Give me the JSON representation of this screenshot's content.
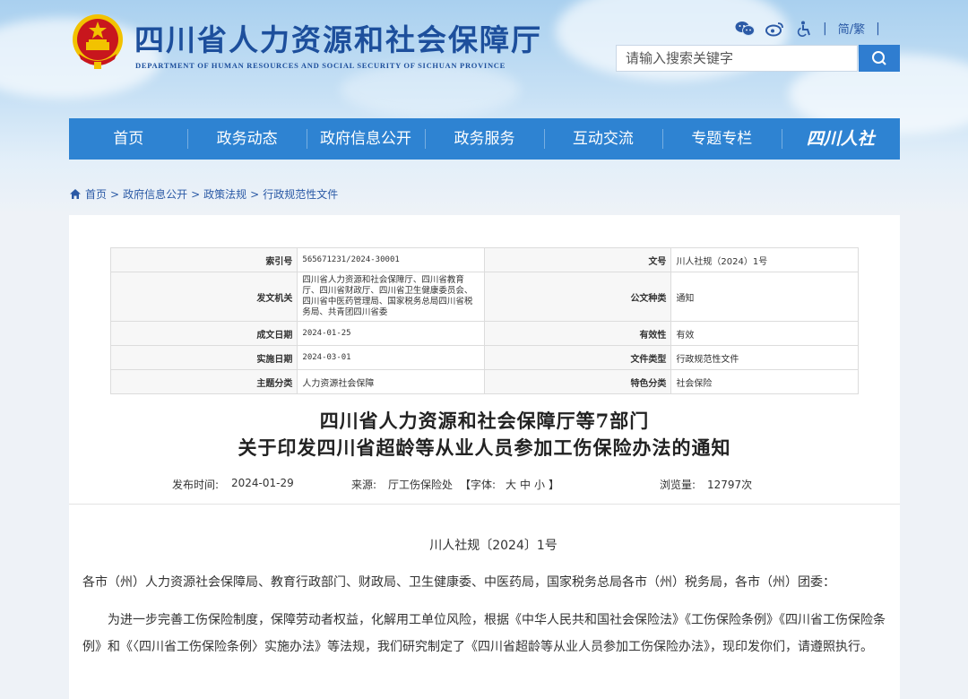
{
  "site": {
    "title": "四川省人力资源和社会保障厅",
    "subtitle": "DEPARTMENT OF HUMAN RESOURCES AND SOCIAL SECURITY OF SICHUAN PROVINCE",
    "lang_toggle": "简/繁",
    "search_placeholder": "请输入搜索关键字"
  },
  "nav": {
    "items": [
      "首页",
      "政务动态",
      "政府信息公开",
      "政务服务",
      "互动交流",
      "专题专栏"
    ],
    "brand": "四川人社"
  },
  "breadcrumb": {
    "home": "首页",
    "sep": ">",
    "items": [
      "政府信息公开",
      "政策法规",
      "行政规范性文件"
    ]
  },
  "meta": {
    "rows": [
      {
        "k1": "索引号",
        "v1": "565671231/2024-30001",
        "k2": "文号",
        "v2": "川人社规（2024）1号"
      },
      {
        "k1": "发文机关",
        "v1": "四川省人力资源和社会保障厅、四川省教育厅、四川省财政厅、四川省卫生健康委员会、四川省中医药管理局、国家税务总局四川省税务局、共青团四川省委",
        "k2": "公文种类",
        "v2": "通知"
      },
      {
        "k1": "成文日期",
        "v1": "2024-01-25",
        "k2": "有效性",
        "v2": "有效"
      },
      {
        "k1": "实施日期",
        "v1": "2024-03-01",
        "k2": "文件类型",
        "v2": "行政规范性文件"
      },
      {
        "k1": "主题分类",
        "v1": "人力资源社会保障",
        "k2": "特色分类",
        "v2": "社会保险"
      }
    ]
  },
  "doc": {
    "title_line1": "四川省人力资源和社会保障厅等7部门",
    "title_line2": "关于印发四川省超龄等从业人员参加工伤保险办法的通知",
    "publish_label": "发布时间:",
    "publish_date": "2024-01-29",
    "source_label": "来源:",
    "source": "厅工伤保险处",
    "font_label": "【字体:",
    "font_large": "大",
    "font_medium": "中",
    "font_small": "小",
    "font_close": "】",
    "views_label": "浏览量:",
    "views": "12797次",
    "docno": "川人社规〔2024〕1号",
    "addressee": "各市（州）人力资源社会保障局、教育行政部门、财政局、卫生健康委、中医药局，国家税务总局各市（州）税务局，各市（州）团委：",
    "body": "为进一步完善工伤保险制度，保障劳动者权益，化解用工单位风险，根据《中华人民共和国社会保险法》《工伤保险条例》《四川省工伤保险条例》和《〈四川省工伤保险条例〉实施办法》等法规，我们研究制定了《四川省超龄等从业人员参加工伤保险办法》，现印发你们，请遵照执行。"
  },
  "colors": {
    "brand_blue": "#1d4f9c",
    "nav_blue": "#2e83d2",
    "emblem_red": "#c8161d",
    "emblem_gold": "#f2c200"
  },
  "icons": [
    "wechat-icon",
    "weibo-icon",
    "accessibility-icon",
    "search-icon",
    "home-icon",
    "national-emblem"
  ]
}
